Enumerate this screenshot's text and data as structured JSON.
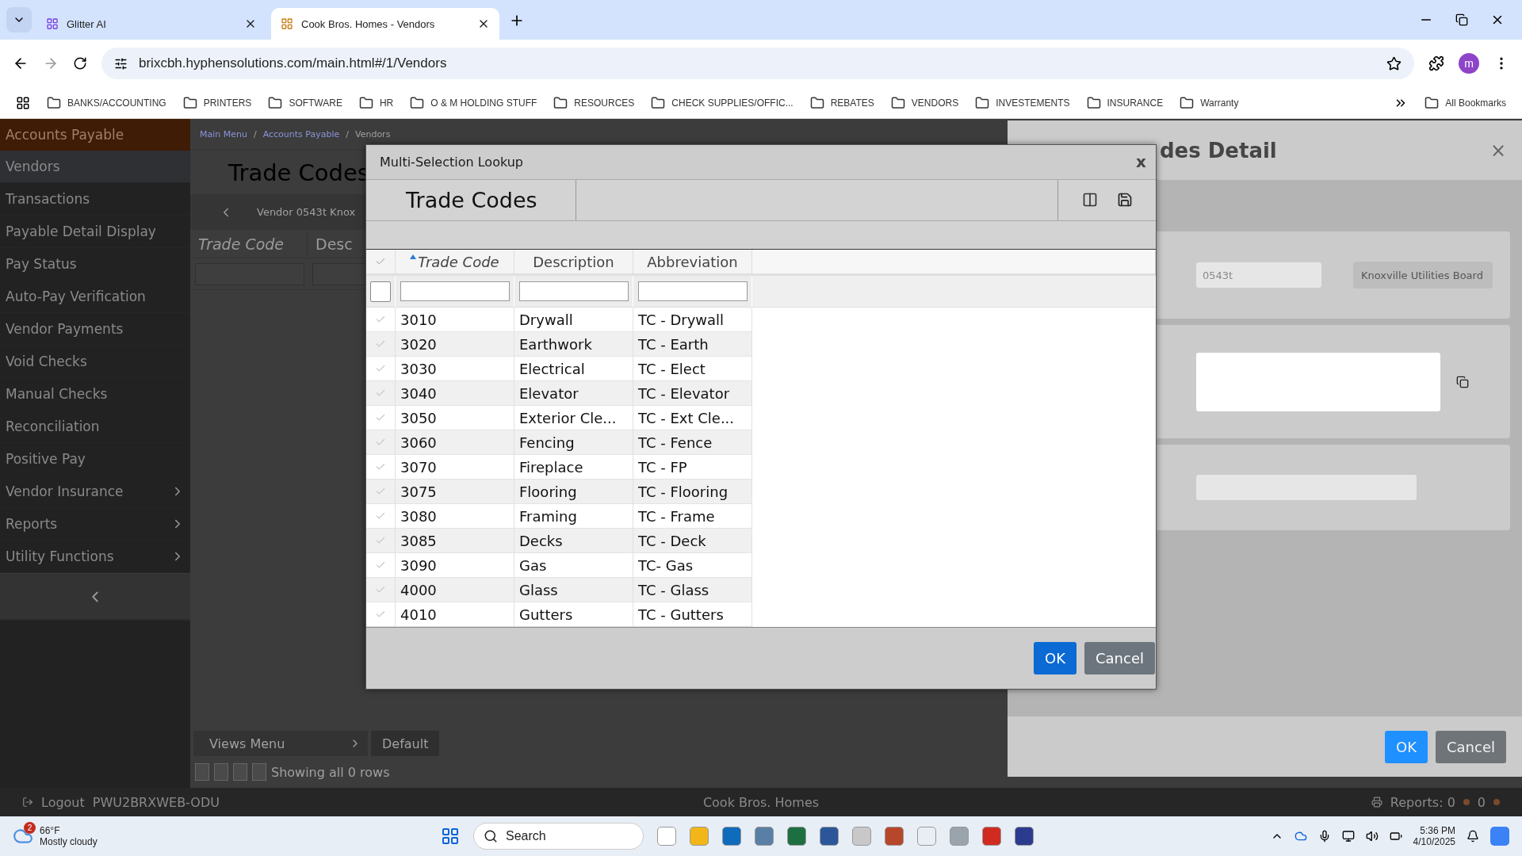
{
  "browser": {
    "tabs": [
      {
        "title": "Glitter AI",
        "selected": false
      },
      {
        "title": "Cook Bros. Homes - Vendors",
        "selected": true
      }
    ],
    "url": "brixcbh.hyphensolutions.com/main.html#/1/Vendors",
    "profile_initial": "m",
    "bookmarks": [
      "BANKS/ACCOUNTING",
      "PRINTERS",
      "SOFTWARE",
      "HR",
      "O & M HOLDING STUFF",
      "RESOURCES",
      "CHECK SUPPLIES/OFFIC...",
      "REBATES",
      "VENDORS",
      "INVESTEMENTS",
      "INSURANCE",
      "Warranty"
    ],
    "all_bookmarks": "All Bookmarks"
  },
  "sidebar": {
    "header": "Accounts Payable",
    "items": [
      {
        "label": "Vendors",
        "selected": true,
        "has_submenu": false
      },
      {
        "label": "Transactions",
        "selected": false,
        "has_submenu": false
      },
      {
        "label": "Payable Detail Display",
        "selected": false,
        "has_submenu": false
      },
      {
        "label": "Pay Status",
        "selected": false,
        "has_submenu": false
      },
      {
        "label": "Auto-Pay Verification",
        "selected": false,
        "has_submenu": false
      },
      {
        "label": "Vendor Payments",
        "selected": false,
        "has_submenu": false
      },
      {
        "label": "Void Checks",
        "selected": false,
        "has_submenu": false
      },
      {
        "label": "Manual Checks",
        "selected": false,
        "has_submenu": false
      },
      {
        "label": "Reconciliation",
        "selected": false,
        "has_submenu": false
      },
      {
        "label": "Positive Pay",
        "selected": false,
        "has_submenu": false
      },
      {
        "label": "Vendor Insurance",
        "selected": false,
        "has_submenu": true
      },
      {
        "label": "Reports",
        "selected": false,
        "has_submenu": true
      },
      {
        "label": "Utility Functions",
        "selected": false,
        "has_submenu": true
      }
    ]
  },
  "main": {
    "breadcrumb": [
      "Main Menu",
      "Accounts Payable",
      "Vendors"
    ],
    "breadcrumb_separator": "/",
    "title": "Trade Codes",
    "vendor_label": "Vendor 0543t Knox",
    "columns": [
      "Trade Code",
      "Desc"
    ],
    "views_menu": "Views Menu",
    "view_tab": "Default",
    "pager_text": "Showing all 0 rows"
  },
  "status_bar": {
    "logout": "Logout",
    "machine": "PWU2BRXWEB-ODU",
    "company": "Cook Bros. Homes",
    "reports": "Reports: 0",
    "reports_count_2": "0"
  },
  "detail_panel": {
    "title": "des Detail",
    "close": "×",
    "vendor_code": "0543t",
    "vendor_name": "Knoxville Utilities Board",
    "ok": "OK",
    "cancel": "Cancel"
  },
  "lookup": {
    "title": "Multi-Selection Lookup",
    "close": "x",
    "heading": "Trade Codes",
    "columns": [
      {
        "label": "Trade Code",
        "sorted": true
      },
      {
        "label": "Description",
        "sorted": false
      },
      {
        "label": "Abbreviation",
        "sorted": false
      }
    ],
    "select_all_checked": false,
    "rows": [
      {
        "code": "3010",
        "description": "Drywall",
        "abbreviation": "TC - Drywall",
        "checked": false
      },
      {
        "code": "3020",
        "description": "Earthwork",
        "abbreviation": "TC - Earth",
        "checked": false
      },
      {
        "code": "3030",
        "description": "Electrical",
        "abbreviation": "TC - Elect",
        "checked": false
      },
      {
        "code": "3040",
        "description": "Elevator",
        "abbreviation": "TC - Elevator",
        "checked": false
      },
      {
        "code": "3050",
        "description": "Exterior Cle...",
        "abbreviation": "TC - Ext Cle...",
        "checked": false
      },
      {
        "code": "3060",
        "description": "Fencing",
        "abbreviation": "TC - Fence",
        "checked": false
      },
      {
        "code": "3070",
        "description": "Fireplace",
        "abbreviation": "TC - FP",
        "checked": false
      },
      {
        "code": "3075",
        "description": "Flooring",
        "abbreviation": "TC - Flooring",
        "checked": false
      },
      {
        "code": "3080",
        "description": "Framing",
        "abbreviation": "TC - Frame",
        "checked": false
      },
      {
        "code": "3085",
        "description": "Decks",
        "abbreviation": "TC - Deck",
        "checked": false
      },
      {
        "code": "3090",
        "description": "Gas",
        "abbreviation": "TC- Gas",
        "checked": false
      },
      {
        "code": "4000",
        "description": "Glass",
        "abbreviation": "TC - Glass",
        "checked": false
      },
      {
        "code": "4010",
        "description": "Gutters",
        "abbreviation": "TC - Gutters",
        "checked": false
      }
    ],
    "ok": "OK",
    "cancel": "Cancel"
  },
  "taskbar": {
    "weather_badge": "2",
    "weather_temp": "66°F",
    "weather_text": "Mostly cloudy",
    "search_placeholder": "Search",
    "time": "5:36 PM",
    "date": "4/10/2025"
  }
}
